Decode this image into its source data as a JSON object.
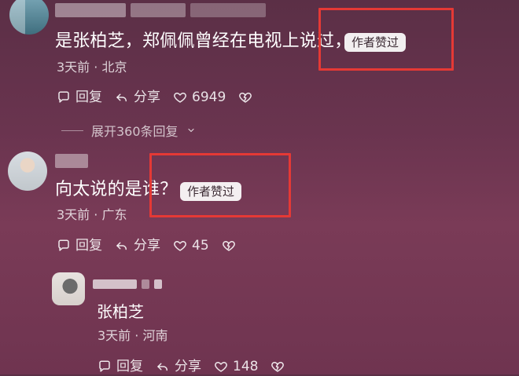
{
  "comments": [
    {
      "text": "是张柏芝，郑佩佩曾经在电视上说过，",
      "badge": "作者赞过",
      "meta": "3天前 · 北京",
      "actions": {
        "reply_label": "回复",
        "share_label": "分享",
        "likes": "6949"
      },
      "expand_label": "展开360条回复"
    },
    {
      "text": "向太说的是谁？",
      "badge": "作者赞过",
      "meta": "3天前 · 广东",
      "actions": {
        "reply_label": "回复",
        "share_label": "分享",
        "likes": "45"
      }
    }
  ],
  "reply": {
    "text": "张柏芝",
    "meta": "3天前 · 河南",
    "actions": {
      "reply_label": "回复",
      "share_label": "分享",
      "likes": "148"
    }
  },
  "colors": {
    "highlight": "#e53935"
  },
  "icons": {
    "reply": "comment-bubble-icon",
    "share": "share-arrow-icon",
    "like": "heart-icon",
    "dislike": "broken-heart-icon",
    "expand": "chevron-down-icon"
  }
}
